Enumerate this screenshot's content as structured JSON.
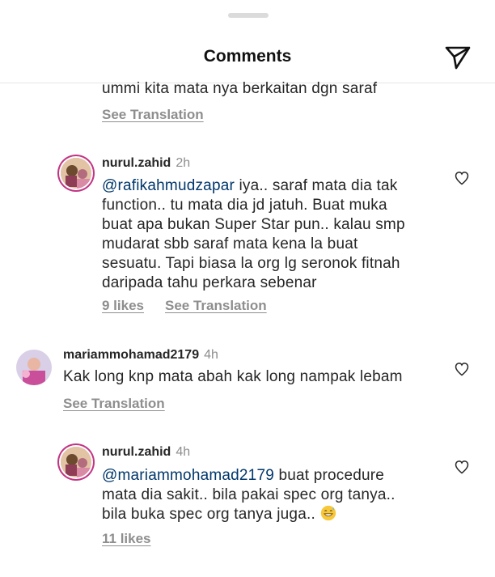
{
  "header": {
    "title": "Comments",
    "share_icon": "paper-plane-icon"
  },
  "comments": [
    {
      "text": "ummi kita mata nya berkaitan dgn saraf",
      "translation": "See Translation"
    },
    {
      "username": "nurul.zahid",
      "time": "2h",
      "mention": "@rafikahmudzapar",
      "lines": [
        " iya.. saraf mata dia tak",
        "function.. tu mata dia jd jatuh. Buat muka",
        "buat apa bukan Super Star pun.. kalau smp",
        "mudarat sbb saraf mata kena la buat",
        "sesuatu. Tapi biasa la org lg seronok fitnah",
        "daripada tahu perkara sebenar"
      ],
      "likes": "9 likes",
      "translation": "See Translation"
    },
    {
      "username": "mariammohamad2179",
      "time": "4h",
      "text": "Kak long knp mata abah kak long nampak lebam",
      "translation": "See Translation"
    },
    {
      "username": "nurul.zahid",
      "time": "4h",
      "mention": "@mariammohamad2179",
      "lines": [
        " buat procedure",
        "mata dia sakit.. bila pakai spec org tanya..",
        "bila buka spec org tanya juga.."
      ],
      "emoji": "grinning-sweat-emoji",
      "likes": "11 likes"
    }
  ],
  "colors": {
    "mention": "#00376b",
    "meta": "#8e8e8e",
    "story_ring": "#c13584"
  }
}
